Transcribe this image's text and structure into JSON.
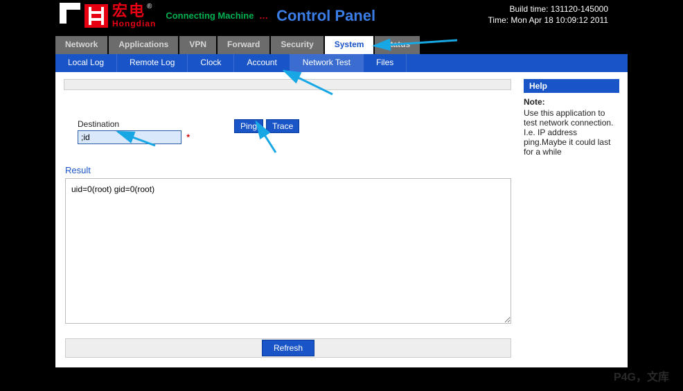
{
  "header": {
    "brand_cn": "宏电",
    "brand_en": "Hongdian",
    "reg_mark": "®",
    "tagline": "Connecting Machine",
    "tagline_dots": "…",
    "title": "Control Panel",
    "build_label": "Build time: 131120-145000",
    "time_label": "Time: Mon Apr 18 10:09:12 2011"
  },
  "nav": {
    "tabs": [
      {
        "label": "Network"
      },
      {
        "label": "Applications"
      },
      {
        "label": "VPN"
      },
      {
        "label": "Forward"
      },
      {
        "label": "Security"
      },
      {
        "label": "System",
        "active": true
      },
      {
        "label": "Status"
      }
    ],
    "subtabs": [
      {
        "label": "Local Log"
      },
      {
        "label": "Remote Log"
      },
      {
        "label": "Clock"
      },
      {
        "label": "Account"
      },
      {
        "label": "Network Test",
        "active": true
      },
      {
        "label": "Files"
      }
    ]
  },
  "form": {
    "destination_label": "Destination",
    "destination_value": ";id",
    "required_mark": "*",
    "ping_label": "Ping",
    "trace_label": "Trace"
  },
  "result": {
    "label": "Result",
    "text": "uid=0(root) gid=0(root)"
  },
  "actions": {
    "refresh_label": "Refresh"
  },
  "help": {
    "header": "Help",
    "note_label": "Note:",
    "note_body": "Use this application to test network connection. I.e. IP address ping.Maybe it could last for a while"
  },
  "footer": {
    "watermark": "P4G，文库"
  }
}
